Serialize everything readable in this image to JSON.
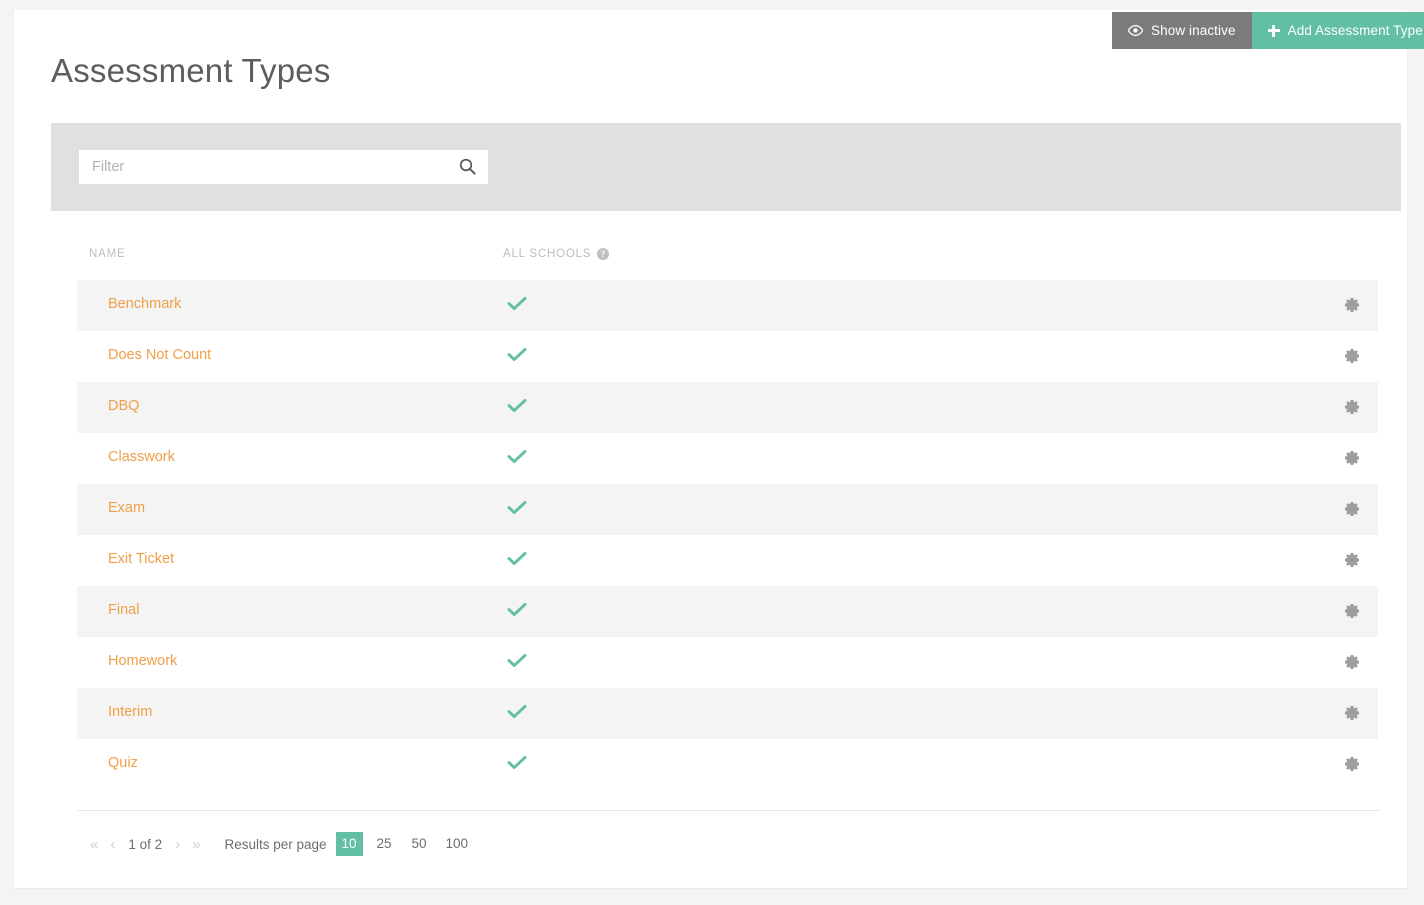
{
  "topbar": {
    "show_inactive_label": "Show inactive",
    "show_inactive_icon": "eye-icon",
    "add_label": "Add Assessment Type",
    "add_icon": "plus-icon",
    "gray": "#7b7b7b",
    "teal": "#62bfa4"
  },
  "header": {
    "title": "Assessment Types"
  },
  "filter": {
    "placeholder": "Filter",
    "value": "",
    "search_icon": "search-icon"
  },
  "table": {
    "columns": {
      "name": "NAME",
      "all_schools": "ALL SCHOOLS",
      "all_schools_help_icon": "help-icon",
      "help_glyph": "?"
    },
    "row_action_icon": "gear-icon",
    "check_icon": "check-icon",
    "link_color": "#ef9f48",
    "check_color": "#62bfa4",
    "rows": [
      {
        "name": "Benchmark",
        "all_schools": true
      },
      {
        "name": "Does Not Count",
        "all_schools": true
      },
      {
        "name": "DBQ",
        "all_schools": true
      },
      {
        "name": "Classwork",
        "all_schools": true
      },
      {
        "name": "Exam",
        "all_schools": true
      },
      {
        "name": "Exit Ticket",
        "all_schools": true
      },
      {
        "name": "Final",
        "all_schools": true
      },
      {
        "name": "Homework",
        "all_schools": true
      },
      {
        "name": "Interim",
        "all_schools": true
      },
      {
        "name": "Quiz",
        "all_schools": true
      }
    ]
  },
  "pagination": {
    "first_glyph": "«",
    "prev_glyph": "‹",
    "next_glyph": "›",
    "last_glyph": "»",
    "page_label": "1 of 2",
    "results_per_page_label": "Results per page",
    "page_sizes": [
      "10",
      "25",
      "50",
      "100"
    ],
    "active_page_size": "10",
    "active_color": "#62bfa4"
  }
}
